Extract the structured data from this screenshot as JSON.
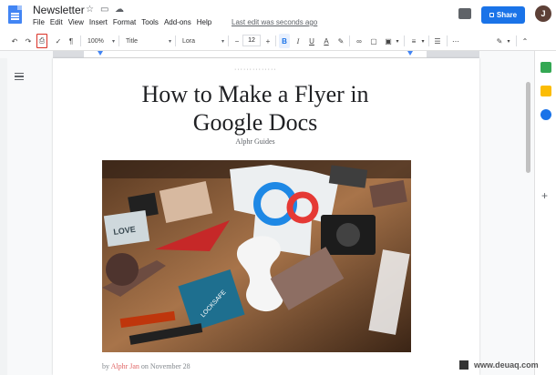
{
  "app": {
    "doc_title": "Newsletter",
    "menu": [
      "File",
      "Edit",
      "View",
      "Insert",
      "Format",
      "Tools",
      "Add-ons",
      "Help"
    ],
    "last_edit": "Last edit was seconds ago",
    "share_label": "Share",
    "avatar_initial": "J"
  },
  "toolbar": {
    "zoom": "100%",
    "style": "Title",
    "font": "Lora",
    "font_size": "12",
    "bold": "B",
    "italic": "I",
    "underline": "U",
    "text_color": "A"
  },
  "document": {
    "title_line1": "How to Make a Flyer in",
    "title_line2": "Google Docs",
    "subtitle": "Alphr Guides",
    "byline_prefix": "by",
    "author": "Alphr Jan",
    "date": "on November 28"
  },
  "watermark": "www.deuaq.com",
  "colors": {
    "accent": "#1a73e8",
    "highlight": "#d93025",
    "author": "#e06666"
  }
}
